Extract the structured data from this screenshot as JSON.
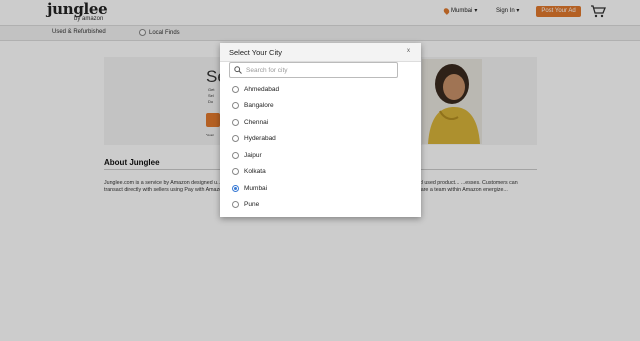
{
  "header": {
    "logo_text": "junglee",
    "logo_sub": "by amazon",
    "location": "Mumbai",
    "signin": "Sign In",
    "post_ad": "Post Your Ad"
  },
  "subnav": {
    "used_refurbished": "Used & Refurbished",
    "local_finds": "Local Finds"
  },
  "banner": {
    "title": "Se",
    "bullets": [
      "Get",
      "Sel",
      "Do"
    ],
    "note": "*Avail"
  },
  "about": {
    "title": "About Junglee",
    "text": "Junglee.com is a service by Amazon designed u... ... ee is the only online marketplace in India which enables customers to buy new and used product... ...esses. Customers can transact directly with sellers using Pay with Amazon - a fast, easy and ... ...oducts on Junglee.com and receiving customer queries. We are a team within Amazon energize..."
  },
  "modal": {
    "title": "Select Your City",
    "close": "x",
    "search_placeholder": "Search for city",
    "cities": [
      {
        "name": "Ahmedabad",
        "selected": false
      },
      {
        "name": "Bangalore",
        "selected": false
      },
      {
        "name": "Chennai",
        "selected": false
      },
      {
        "name": "Hyderabad",
        "selected": false
      },
      {
        "name": "Jaipur",
        "selected": false
      },
      {
        "name": "Kolkata",
        "selected": false
      },
      {
        "name": "Mumbai",
        "selected": true
      },
      {
        "name": "Pune",
        "selected": false
      }
    ]
  },
  "colors": {
    "accent": "#e1782c",
    "radio_selected": "#3a7bd5"
  }
}
